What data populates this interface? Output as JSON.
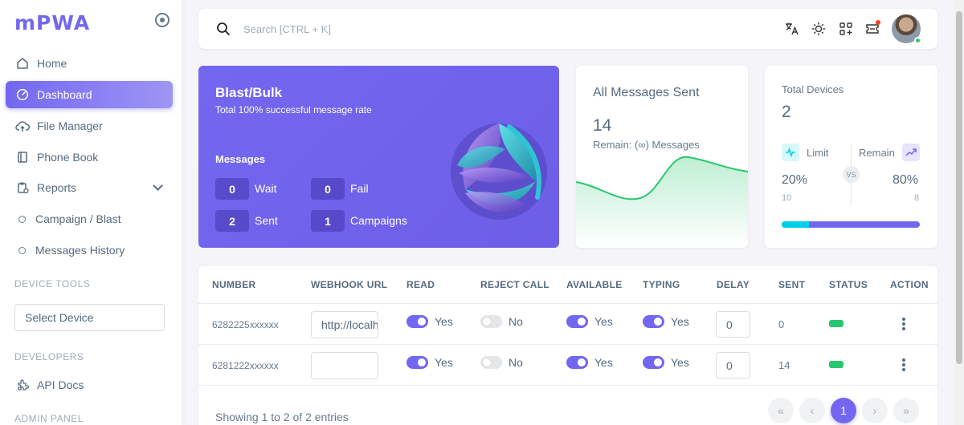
{
  "brand": {
    "name": "mPWA"
  },
  "sidebar": {
    "items": [
      {
        "label": "Home"
      },
      {
        "label": "Dashboard"
      },
      {
        "label": "File Manager"
      },
      {
        "label": "Phone Book"
      },
      {
        "label": "Reports"
      }
    ],
    "reports_sub": [
      {
        "label": "Campaign / Blast"
      },
      {
        "label": "Messages History"
      }
    ],
    "device_tools_label": "DEVICE TOOLS",
    "select_device": "Select Device",
    "developers_label": "DEVELOPERS",
    "api_docs": "API Docs",
    "admin_panel_label": "ADMIN PANEL"
  },
  "search": {
    "placeholder": "Search [CTRL + K]"
  },
  "blast": {
    "title": "Blast/Bulk",
    "subtitle": "Total 100% successful message rate",
    "messages_label": "Messages",
    "stats": [
      {
        "value": "0",
        "label": "Wait"
      },
      {
        "value": "0",
        "label": "Fail"
      },
      {
        "value": "2",
        "label": "Sent"
      },
      {
        "value": "1",
        "label": "Campaigns"
      }
    ]
  },
  "sent_card": {
    "title": "All Messages Sent",
    "value": "14",
    "remain": "Remain: (∞) Messages"
  },
  "devices_card": {
    "title": "Total Devices",
    "value": "2",
    "limit_label": "Limit",
    "remain_label": "Remain",
    "limit_pct": "20%",
    "remain_pct": "80%",
    "limit_count": "10",
    "remain_count": "8",
    "vs": "VS",
    "progress_fraction": 0.2
  },
  "table": {
    "headers": [
      "NUMBER",
      "WEBHOOK URL",
      "READ",
      "REJECT CALL",
      "AVAILABLE",
      "TYPING",
      "DELAY",
      "SENT",
      "STATUS",
      "ACTION"
    ],
    "rows": [
      {
        "number": "6282225xxxxxx",
        "webhook": "http://localhost",
        "read": "Yes",
        "reject": "No",
        "available": "Yes",
        "typing": "Yes",
        "delay": "0",
        "sent": "0"
      },
      {
        "number": "6281222xxxxxx",
        "webhook": "",
        "read": "Yes",
        "reject": "No",
        "available": "Yes",
        "typing": "Yes",
        "delay": "0",
        "sent": "14"
      }
    ],
    "entries": "Showing 1 to 2 of 2 entries",
    "pagination": {
      "first": "«",
      "prev": "‹",
      "current": "1",
      "next": "›",
      "last": "»"
    }
  },
  "colors": {
    "primary": "#7367f0",
    "success": "#28c76f",
    "info": "#00cfe8"
  }
}
